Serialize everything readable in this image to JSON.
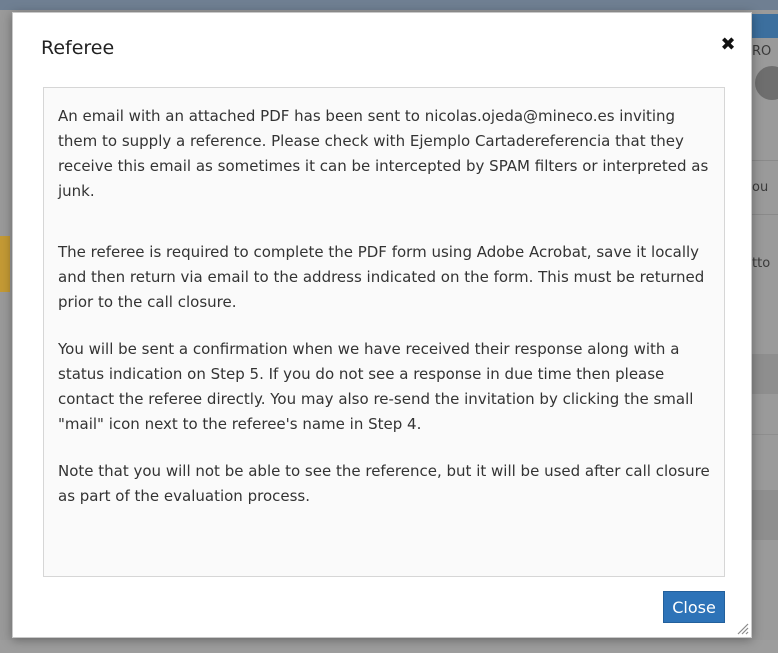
{
  "dialog": {
    "title": "Referee",
    "close_glyph": "✖",
    "paragraphs": [
      "An email with an attached PDF has been sent to nicolas.ojeda@mineco.es inviting them to supply a reference. Please check with Ejemplo Cartadereferencia that they receive this email as sometimes it can be intercepted by SPAM filters or interpreted as junk.",
      "The referee is required to complete the PDF form using Adobe Acrobat, save it locally and then return via email to the address indicated on the form. This must be returned prior to the call closure.",
      "You will be sent a confirmation when we have received their response along with a status indication on Step 5. If you do not see a response in due time then please contact the referee directly. You may also re-send the invitation by clicking the small \"mail\" icon next to the referee's name in Step 4.",
      "Note that you will not be able to see the reference, but it will be used after call closure as part of the evaluation process."
    ],
    "close_button_label": "Close"
  },
  "background": {
    "header_fragment": "RO",
    "fragment_1": "ou",
    "fragment_2": "tto"
  },
  "colors": {
    "primary_button": "#2d73b8",
    "overlay": "#8f8f8f"
  }
}
